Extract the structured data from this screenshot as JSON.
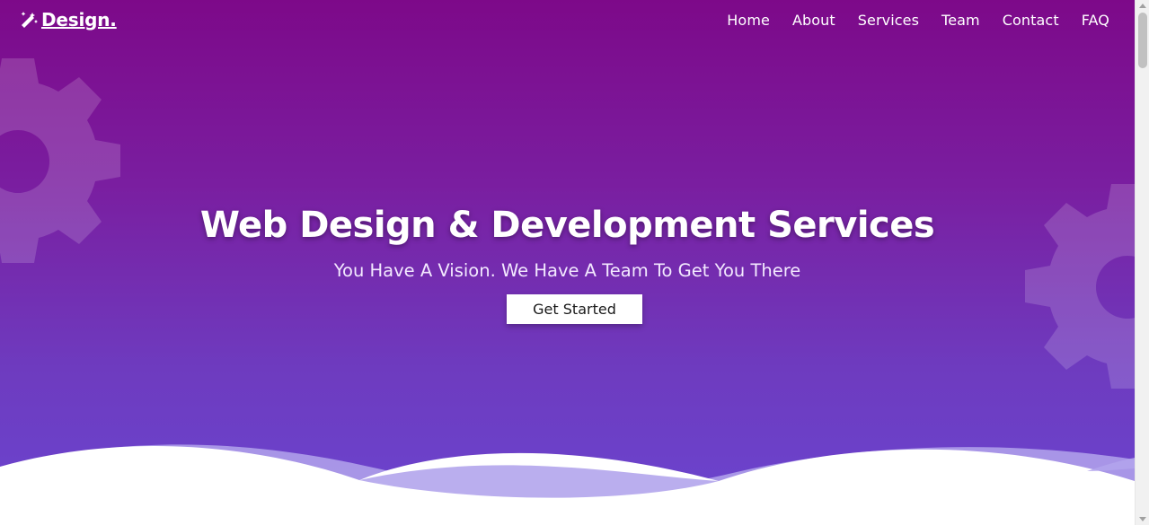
{
  "brand": {
    "name": "Design.",
    "logo_icon": "magic-wand-icon"
  },
  "nav": {
    "items": [
      {
        "label": "Home"
      },
      {
        "label": "About"
      },
      {
        "label": "Services"
      },
      {
        "label": "Team"
      },
      {
        "label": "Contact"
      },
      {
        "label": "FAQ"
      }
    ]
  },
  "hero": {
    "title": "Web Design & Development Services",
    "subtitle": "You Have A Vision. We Have A Team To Get You There",
    "cta_label": "Get Started",
    "decor_icons": [
      "gear-icon",
      "gear-icon"
    ],
    "colors": {
      "gradient_top": "#7d0989",
      "gradient_bottom": "#6a45d0",
      "wave_light": "#b3a5ec",
      "wave_front": "#ffffff"
    }
  }
}
